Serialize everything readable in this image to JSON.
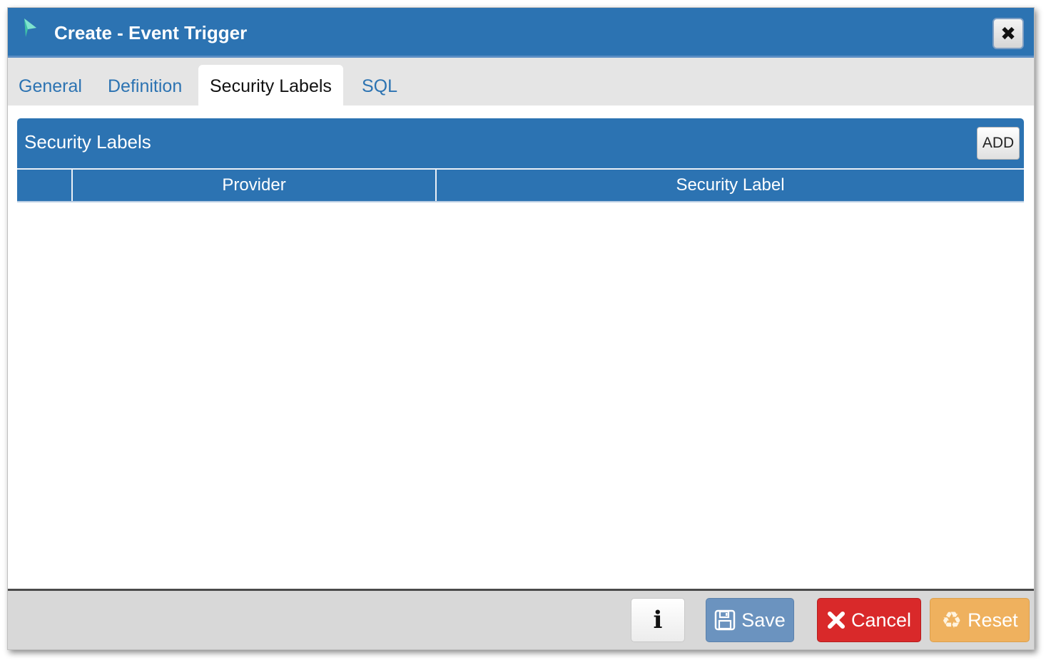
{
  "dialog": {
    "title": "Create - Event Trigger",
    "close_glyph": "✖"
  },
  "tabs": [
    {
      "label": "General",
      "active": false
    },
    {
      "label": "Definition",
      "active": false
    },
    {
      "label": "Security Labels",
      "active": true
    },
    {
      "label": "SQL",
      "active": false
    }
  ],
  "panel": {
    "title": "Security Labels",
    "add_label": "ADD",
    "columns": [
      "",
      "Provider",
      "Security Label"
    ],
    "rows": []
  },
  "footer": {
    "info_glyph": "i",
    "save_label": "Save",
    "cancel_label": "Cancel",
    "reset_label": "Reset"
  },
  "colors": {
    "primary": "#2c73b2",
    "save": "#6b93bf",
    "cancel": "#d9292a",
    "reset": "#efb15e"
  },
  "icons": {
    "app": "event-trigger-icon",
    "close": "close-icon",
    "info": "info-icon",
    "save": "floppy-disk-icon",
    "cancel": "x-mark-icon",
    "reset": "recycle-icon"
  }
}
